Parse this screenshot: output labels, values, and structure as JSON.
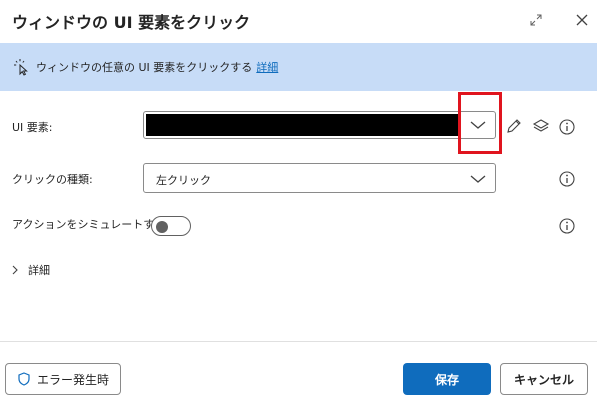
{
  "window": {
    "title": "ウィンドウの UI 要素をクリック"
  },
  "banner": {
    "text": "ウィンドウの任意の UI 要素をクリックする",
    "link": "詳細"
  },
  "form": {
    "ui_element": {
      "label": "UI 要素:",
      "value_redacted": true
    },
    "click_type": {
      "label": "クリックの種類:",
      "value": "左クリック"
    },
    "simulate_action": {
      "label": "アクションをシミュレートする:",
      "enabled": false
    },
    "details": {
      "label": "詳細"
    }
  },
  "footer": {
    "error_button": "エラー発生時",
    "save_button": "保存",
    "cancel_button": "キャンセル"
  },
  "colors": {
    "accent": "#0f6cbd",
    "banner_bg": "#c7dcf7",
    "highlight": "#e0141e"
  },
  "icons": {
    "banner": "pointer-click-icon",
    "edit": "pencil-icon",
    "layers": "layers-icon",
    "info": "info-icon",
    "expand": "expand-icon",
    "close": "close-icon",
    "shield": "shield-icon"
  }
}
